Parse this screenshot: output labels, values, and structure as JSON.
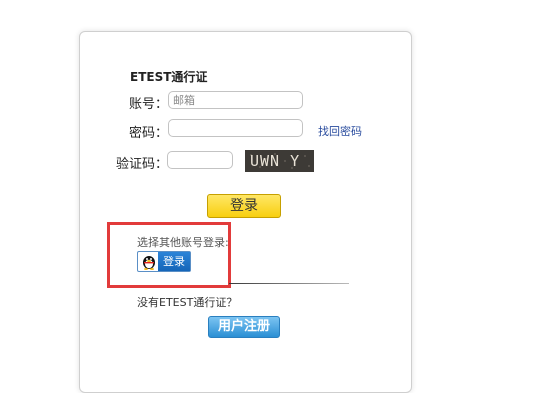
{
  "login": {
    "title": "ETEST通行证",
    "account_label": "账号：",
    "account_placeholder": "邮箱",
    "password_label": "密码：",
    "forgot_password": "找回密码",
    "captcha_label": "验证码：",
    "captcha_text": "UWN Y",
    "login_button": "登录"
  },
  "other_login": {
    "label": "选择其他账号登录:",
    "qq_button": "登录",
    "highlight_color": "#e23b3b"
  },
  "register": {
    "prompt": "没有ETEST通行证？",
    "button": "用户注册"
  }
}
